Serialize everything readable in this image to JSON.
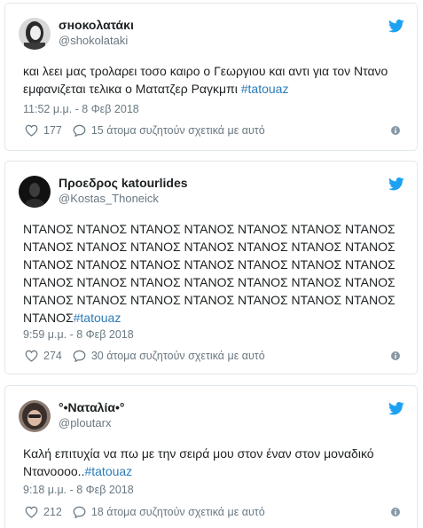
{
  "tweets": [
    {
      "name": "σнοκολατάκι",
      "handle": "@shokolataki",
      "text": "και λεει μας τρολαρει τοσο καιρο ο Γεωργιου και αντι για τον Ντανο εμφανιζεται τελικα ο Ματατζερ Ραγκμπι ",
      "hashtag": "#tatouaz",
      "time": "11:52 μ.μ. - 8 Φεβ 2018",
      "likes": "177",
      "talking": "15 άτομα συζητούν σχετικά με αυτό"
    },
    {
      "name": "Προεδρος katourlides",
      "handle": "@Kostas_Thoneick",
      "text": "ΝΤΑΝΟΣ ΝΤΑΝΟΣ ΝΤΑΝΟΣ ΝΤΑΝΟΣ ΝΤΑΝΟΣ ΝΤΑΝΟΣ ΝΤΑΝΟΣ ΝΤΑΝΟΣ ΝΤΑΝΟΣ ΝΤΑΝΟΣ ΝΤΑΝΟΣ ΝΤΑΝΟΣ ΝΤΑΝΟΣ ΝΤΑΝΟΣ ΝΤΑΝΟΣ ΝΤΑΝΟΣ ΝΤΑΝΟΣ ΝΤΑΝΟΣ ΝΤΑΝΟΣ ΝΤΑΝΟΣ ΝΤΑΝΟΣ ΝΤΑΝΟΣ ΝΤΑΝΟΣ ΝΤΑΝΟΣ ΝΤΑΝΟΣ ΝΤΑΝΟΣ ΝΤΑΝΟΣ ΝΤΑΝΟΣ ΝΤΑΝΟΣ ΝΤΑΝΟΣ ΝΤΑΝΟΣ ΝΤΑΝΟΣ ΝΤΑΝΟΣ ΝΤΑΝΟΣ ΝΤΑΝΟΣ ΝΤΑΝΟΣ",
      "hashtag": "#tatouaz",
      "time": "9:59 μ.μ. - 8 Φεβ 2018",
      "likes": "274",
      "talking": "30 άτομα συζητούν σχετικά με αυτό"
    },
    {
      "name": "°•Ναταλία•°",
      "handle": "@ploutarx",
      "text": "Καλή επιτυχία να πω με την σειρά μου στον έναν στον μοναδικό Ντανοοοο..",
      "hashtag": "#tatouaz",
      "time": "9:18 μ.μ. - 8 Φεβ 2018",
      "likes": "212",
      "talking": "18 άτομα συζητούν σχετικά με αυτό"
    }
  ],
  "colors": {
    "text": "#1c2022",
    "meta": "#697882",
    "hashtag": "#2b7bb9",
    "twitter_bird": "#1da1f2",
    "border": "#e1e8ed"
  },
  "icons": [
    "twitter-bird-icon",
    "heart-icon",
    "speech-bubble-icon",
    "info-icon"
  ]
}
